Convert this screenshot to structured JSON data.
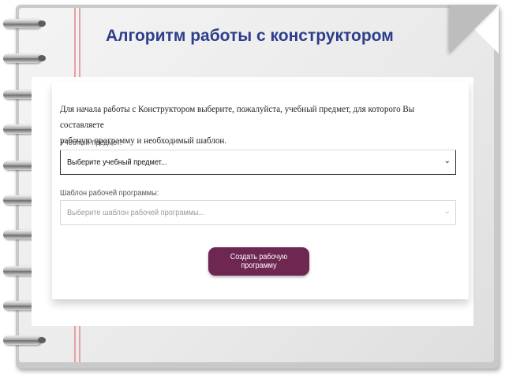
{
  "slide": {
    "title": "Алгоритм работы с конструктором"
  },
  "form": {
    "intro_line1": "Для начала работы с Конструктором выберите, пожалуйста, учебный предмет, для которого Вы составляете",
    "intro_line2": "рабочую программу и необходимый шаблон.",
    "subject": {
      "label": "Учебный предмет:",
      "value": "Выберите учебный предмет..."
    },
    "template": {
      "label": "Шаблон рабочей программы:",
      "placeholder": "Выберите шаблон рабочей программы..."
    },
    "create_button": "Создать рабочую программу"
  },
  "colors": {
    "title": "#2c3e8c",
    "button": "#6d2750",
    "margin_line": "#e2a3a3"
  },
  "icons": {
    "select_arrow": "chevron-down-icon"
  }
}
